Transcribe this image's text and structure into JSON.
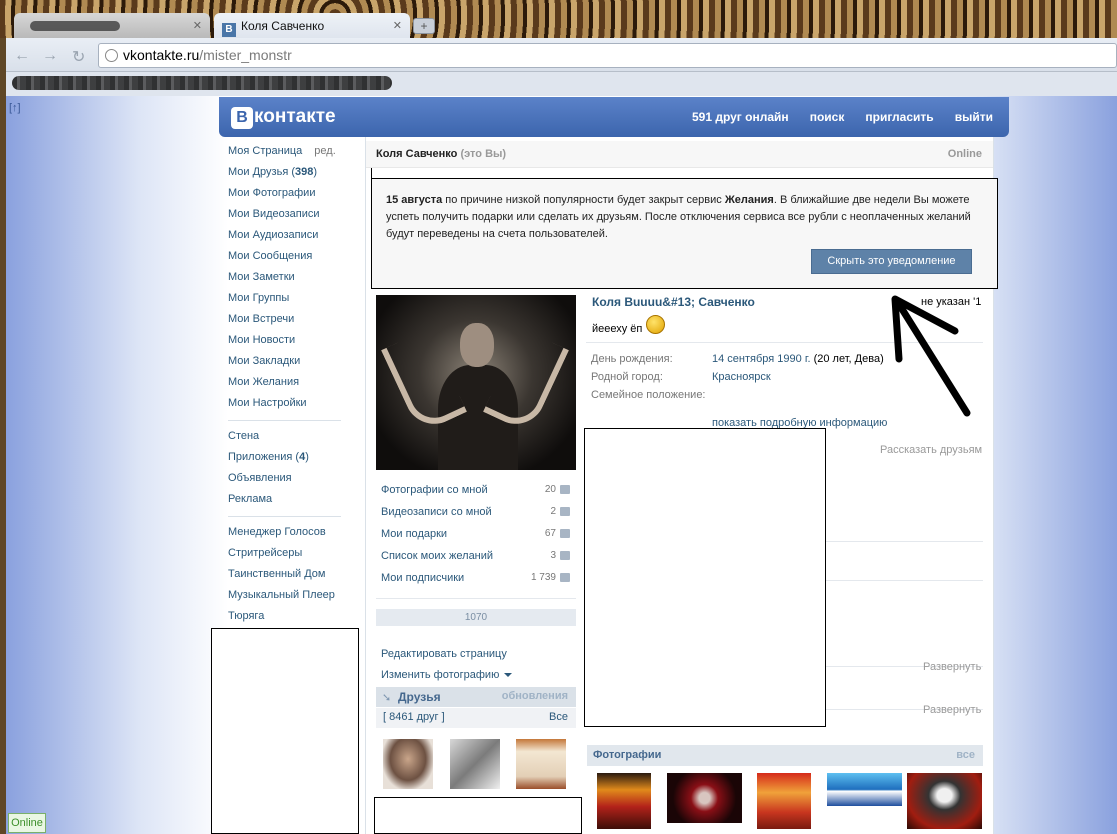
{
  "browser": {
    "tabs": [
      {
        "label": "",
        "active": false
      },
      {
        "label": "Коля Савченко",
        "active": true
      }
    ],
    "url_host": "vkontakte.ru",
    "url_path": "/mister_monstr",
    "new_tab": "+"
  },
  "side_marker": "[↑]",
  "header": {
    "logo": "контакте",
    "logo_letter": "В",
    "nav": [
      "591 друг онлайн",
      "поиск",
      "пригласить",
      "выйти"
    ]
  },
  "menu": {
    "group1": [
      {
        "label": "Моя Страница",
        "extra": "ред."
      },
      {
        "label": "Мои Друзья",
        "count": "398"
      },
      {
        "label": "Мои Фотографии"
      },
      {
        "label": "Мои Видеозаписи"
      },
      {
        "label": "Мои Аудиозаписи"
      },
      {
        "label": "Мои Сообщения"
      },
      {
        "label": "Мои Заметки"
      },
      {
        "label": "Мои Группы"
      },
      {
        "label": "Мои Встречи"
      },
      {
        "label": "Мои Новости"
      },
      {
        "label": "Мои Закладки"
      },
      {
        "label": "Мои Желания"
      },
      {
        "label": "Мои Настройки"
      }
    ],
    "group2": [
      {
        "label": "Стена"
      },
      {
        "label": "Приложения",
        "count": "4"
      },
      {
        "label": "Объявления"
      },
      {
        "label": "Реклама"
      }
    ],
    "group3": [
      {
        "label": "Менеджер Голосов"
      },
      {
        "label": "Стритрейсеры"
      },
      {
        "label": "Таинственный Дом"
      },
      {
        "label": "Музыкальный Плеер"
      },
      {
        "label": "Тюряга"
      }
    ]
  },
  "page_header": {
    "name": "Коля Савченко",
    "you": "(это Вы)",
    "status": "Online"
  },
  "notice": {
    "date": "15 августа",
    "text1": " по причине низкой популярности будет закрыт сервис ",
    "service": "Желания",
    "text2": ". В ближайшие две недели Вы можете успеть получить подарки или сделать их друзьям. После отключения сервиса все рубли с неоплаченных желаний будут переведены на счета пользователей.",
    "button": "Скрыть это уведомление"
  },
  "stats": [
    {
      "label": "Фотографии со мной",
      "count": "20"
    },
    {
      "label": "Видеозаписи со мной",
      "count": "2"
    },
    {
      "label": "Мои подарки",
      "count": "67"
    },
    {
      "label": "Список моих желаний",
      "count": "3"
    },
    {
      "label": "Мои подписчики",
      "count": "1 739"
    }
  ],
  "rating": "1070",
  "actions": {
    "edit": "Редактировать страницу",
    "change_photo": "Изменить фотографию"
  },
  "friends": {
    "title": "Друзья",
    "updates": "обновления",
    "count": "[ 8461 друг ]",
    "all": "Все"
  },
  "profile": {
    "full_name": "Коля Вuuuu&#13; Савченко",
    "not_set": "не указан '1",
    "status_text": "йееехy ёп",
    "info": [
      {
        "label": "День рождения:",
        "value": "14 сентября 1990 г.",
        "extra": " (20 лет, Дева)"
      },
      {
        "label": "Родной город:",
        "value": "Красноярск",
        "extra": ""
      },
      {
        "label": "Семейное положение:",
        "value": "",
        "extra": ""
      }
    ],
    "more_info": "показать подробную информацию",
    "tell_friends": "Рассказать друзьям",
    "expand": "Развернуть"
  },
  "photos": {
    "title": "Фотографии",
    "all": "все"
  },
  "online_badge": "Online",
  "colors": {
    "vk_blue": "#45688e",
    "link": "#2b587a",
    "header_bg": "#3c65ad"
  }
}
